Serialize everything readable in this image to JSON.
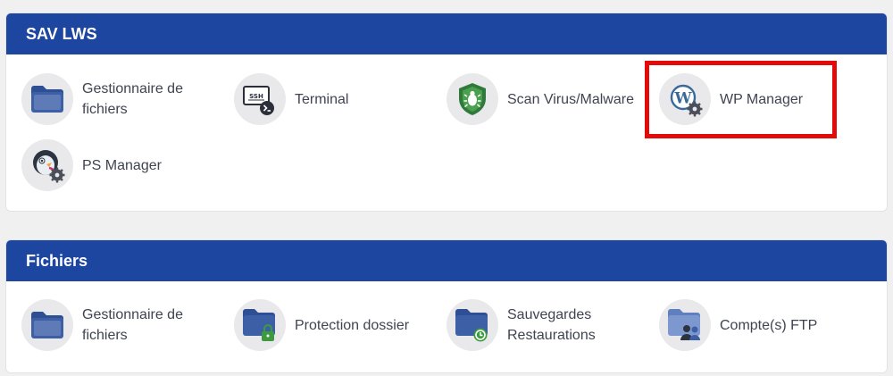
{
  "sections": [
    {
      "title": "SAV LWS",
      "items": [
        {
          "label": "Gestionnaire de fichiers",
          "icon": "folder-icon"
        },
        {
          "label": "Terminal",
          "icon": "ssh-terminal-icon"
        },
        {
          "label": "Scan Virus/Malware",
          "icon": "shield-bug-icon"
        },
        {
          "label": "WP Manager",
          "icon": "wordpress-gear-icon"
        },
        {
          "label": "PS Manager",
          "icon": "prestashop-gear-icon"
        }
      ]
    },
    {
      "title": "Fichiers",
      "items": [
        {
          "label": "Gestionnaire de fichiers",
          "icon": "folder-icon"
        },
        {
          "label": "Protection dossier",
          "icon": "folder-lock-icon"
        },
        {
          "label": "Sauvegardes Restaurations",
          "icon": "folder-backup-icon"
        },
        {
          "label": "Compte(s) FTP",
          "icon": "folder-users-icon"
        }
      ]
    }
  ],
  "colors": {
    "header_bg": "#1d46a0",
    "highlight": "#e30a0a",
    "icon_circle": "#e9e9eb",
    "folder": "#3d5fa6"
  }
}
